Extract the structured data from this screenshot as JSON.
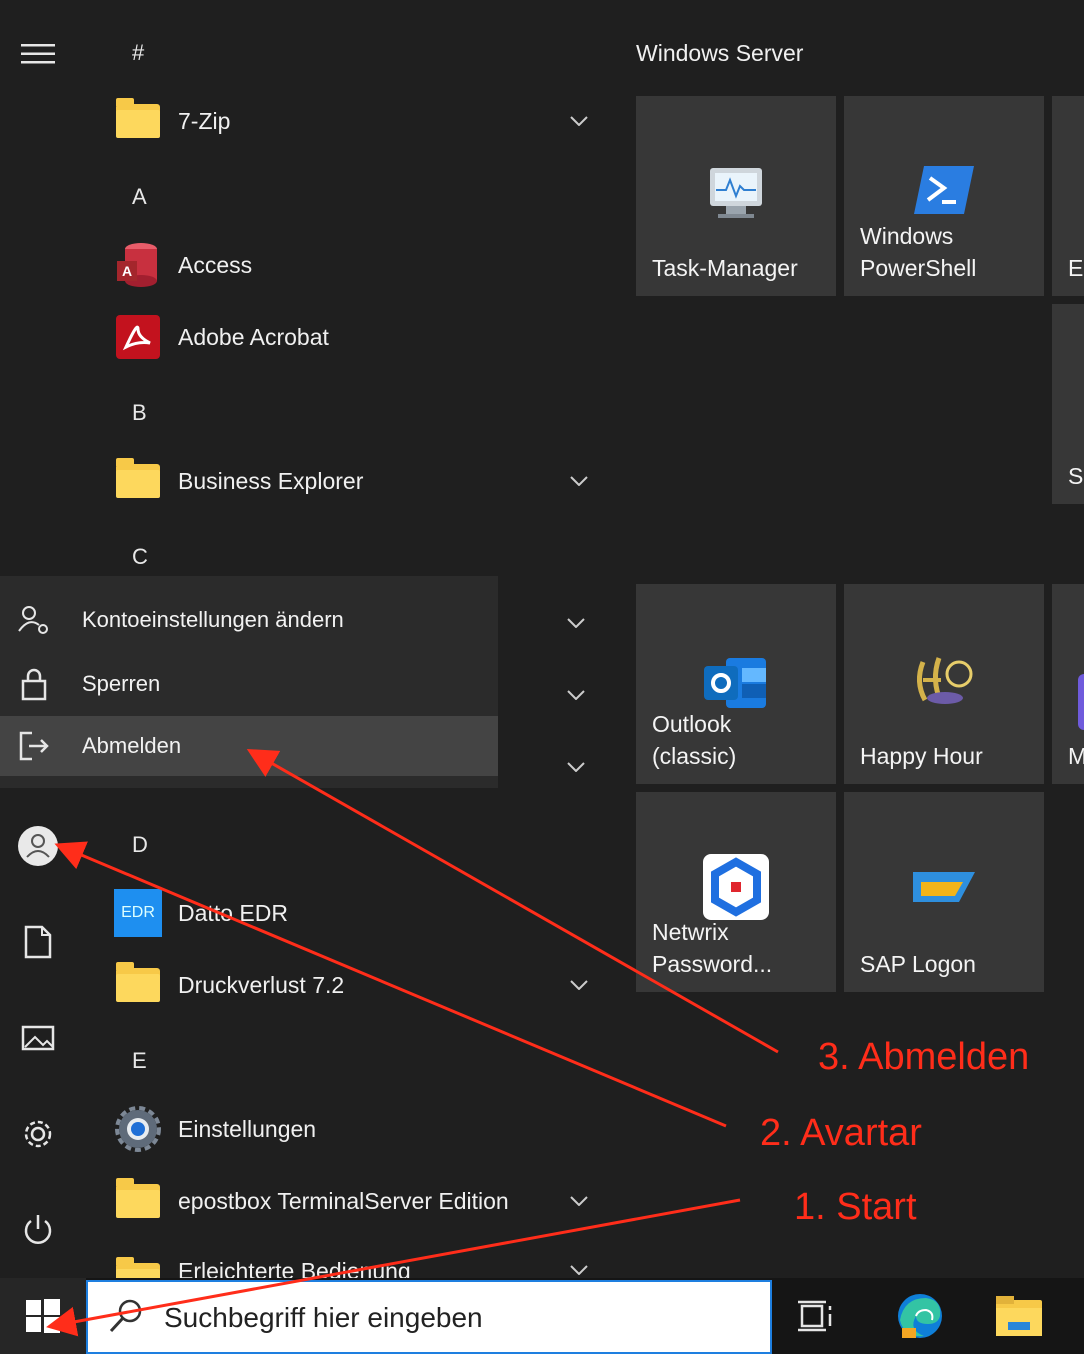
{
  "app_list": {
    "letters": {
      "hash": "#",
      "a": "A",
      "b": "B",
      "c": "C",
      "d": "D",
      "e": "E"
    },
    "items": {
      "zip": "7-Zip",
      "access": "Access",
      "acrobat": "Adobe Acrobat",
      "business_explorer": "Business Explorer",
      "datto": "Datto EDR",
      "druckverlust": "Druckverlust 7.2",
      "einstellungen": "Einstellungen",
      "epostbox": "epostbox TerminalServer Edition",
      "erleichterte": "Erleichterte Bedienung"
    },
    "datto_icon_text": "EDR"
  },
  "account_menu": {
    "change_settings": "Kontoeinstellungen ändern",
    "lock": "Sperren",
    "sign_out": "Abmelden"
  },
  "tiles": {
    "group_title": "Windows Server",
    "task_manager": "Task-Manager",
    "powershell": "Windows\nPowerShell",
    "partial_e": "E",
    "partial_s": "S",
    "outlook": "Outlook\n(classic)",
    "happy_hour": "Happy Hour",
    "partial_m": "M",
    "netwrix": "Netwrix\nPassword...",
    "sap": "SAP Logon"
  },
  "taskbar": {
    "search_placeholder": "Suchbegriff hier eingeben"
  },
  "annotations": {
    "step1": "1. Start",
    "step2": "2. Avartar",
    "step3": "3. Abmelden"
  },
  "colors": {
    "annotation": "#ff2d1a",
    "background": "#1f1f1f",
    "tile": "#373737"
  }
}
